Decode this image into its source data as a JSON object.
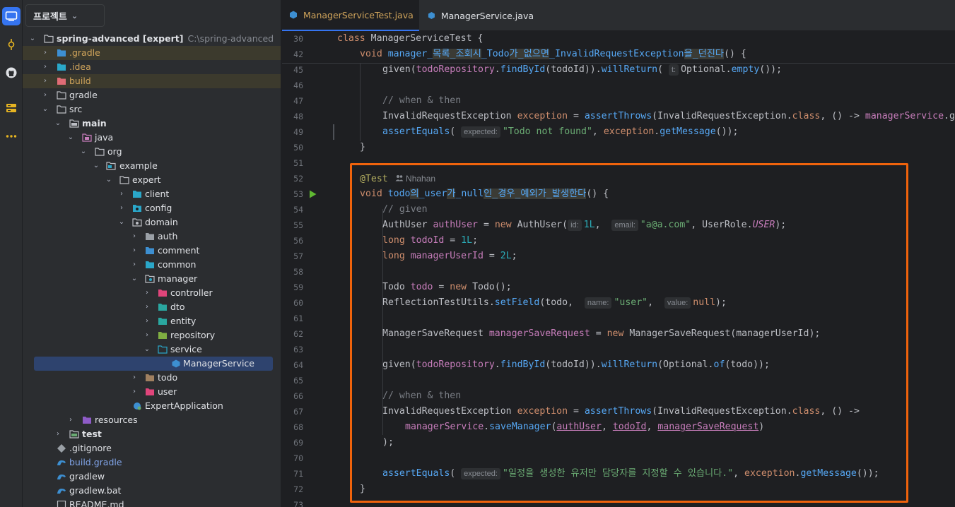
{
  "project": {
    "header": "프로젝트",
    "tree": [
      {
        "label": "spring-advanced [expert]",
        "sub": "C:\\spring-advanced",
        "icon": "module-folder-icon"
      },
      {
        "label": ".gradle",
        "icon": "folder-icon"
      },
      {
        "label": ".idea",
        "icon": "folder-icon"
      },
      {
        "label": "build",
        "icon": "folder-icon"
      },
      {
        "label": "gradle",
        "icon": "folder-icon"
      },
      {
        "label": "src",
        "icon": "folder-icon"
      },
      {
        "label": "main",
        "icon": "folder-icon"
      },
      {
        "label": "java",
        "icon": "source-folder-icon"
      },
      {
        "label": "org",
        "icon": "package-icon"
      },
      {
        "label": "example",
        "icon": "package-icon"
      },
      {
        "label": "expert",
        "icon": "package-icon"
      },
      {
        "label": "client",
        "icon": "package-icon"
      },
      {
        "label": "config",
        "icon": "package-icon"
      },
      {
        "label": "domain",
        "icon": "package-icon"
      },
      {
        "label": "auth",
        "icon": "package-icon"
      },
      {
        "label": "comment",
        "icon": "package-icon"
      },
      {
        "label": "common",
        "icon": "package-icon"
      },
      {
        "label": "manager",
        "icon": "package-icon"
      },
      {
        "label": "controller",
        "icon": "package-icon"
      },
      {
        "label": "dto",
        "icon": "package-icon"
      },
      {
        "label": "entity",
        "icon": "package-icon"
      },
      {
        "label": "repository",
        "icon": "package-icon"
      },
      {
        "label": "service",
        "icon": "package-icon"
      },
      {
        "label": "ManagerService",
        "icon": "interface-icon"
      },
      {
        "label": "todo",
        "icon": "package-icon"
      },
      {
        "label": "user",
        "icon": "package-icon"
      },
      {
        "label": "ExpertApplication",
        "icon": "spring-app-icon"
      },
      {
        "label": "resources",
        "icon": "resources-folder-icon"
      },
      {
        "label": "test",
        "icon": "test-folder-icon"
      },
      {
        "label": ".gitignore",
        "icon": "git-icon"
      },
      {
        "label": "build.gradle",
        "icon": "gradle-icon"
      },
      {
        "label": "gradlew",
        "icon": "gradle-icon"
      },
      {
        "label": "gradlew.bat",
        "icon": "gradle-icon"
      },
      {
        "label": "README.md",
        "icon": "markdown-icon"
      }
    ]
  },
  "tabs": [
    {
      "label": "ManagerServiceTest.java",
      "active": true
    },
    {
      "label": "ManagerService.java",
      "active": false
    }
  ],
  "line_numbers": [
    "30",
    "42",
    "45",
    "46",
    "47",
    "48",
    "49",
    "50",
    "51",
    "52",
    "53",
    "54",
    "55",
    "56",
    "57",
    "58",
    "59",
    "60",
    "61",
    "62",
    "63",
    "64",
    "65",
    "66",
    "67",
    "68",
    "69",
    "70",
    "71",
    "72",
    "73"
  ],
  "code": {
    "l30": {
      "kw": "class ",
      "name": "ManagerServiceTest {"
    },
    "l42": {
      "kw": "void ",
      "p1": "manager_",
      "h1": "목록_조회시",
      "p2": "_Todo",
      "h2": "가_없으면",
      "p3": "_InvalidRequestException",
      "h3": "을_던진다",
      "p4": "() {"
    },
    "l45": {
      "a": "given(",
      "b": "todoRepository",
      "c": ".",
      "d": "findById",
      "e": "(todoId)).",
      "f": "willReturn",
      "g": "( ",
      "hint": "t:",
      "h": "Optional.",
      "i": "empty",
      "j": "());"
    },
    "l47": "// when & then",
    "l48": {
      "a": "InvalidRequestException ",
      "b": "exception",
      "c": " = ",
      "d": "assertThrows",
      "e": "(InvalidRequestException.",
      "f": "class",
      "g": ", () -> ",
      "h": "managerService",
      "i": ".g"
    },
    "l49": {
      "a": "assertEquals",
      "b": "( ",
      "hint": "expected:",
      "c": "\"Todo not found\"",
      "d": ", ",
      "e": "exception",
      "f": ".",
      "g": "getMessage",
      "h": "());"
    },
    "l50": "}",
    "l52": {
      "an": "@Test",
      "author": "Nhahan"
    },
    "l53": {
      "kw": "void ",
      "p1": "todo",
      "h1": "의",
      "p2": "_user",
      "h2": "가",
      "p3": "_null",
      "h3": "인_경우_예외가_발생한다",
      "p4": "() {"
    },
    "l54": "// given",
    "l55": {
      "a": "AuthUser ",
      "b": "authUser",
      "c": " = ",
      "d": "new ",
      "e": "AuthUser(",
      "hint1": "id:",
      "f": "1L",
      "g": ",  ",
      "hint2": "email:",
      "h": "\"a@a.com\"",
      "i": ", UserRole.",
      "j": "USER",
      "k": ");"
    },
    "l56": {
      "kw": "long ",
      "v": "todoId",
      "eq": " = ",
      "n": "1L",
      "s": ";"
    },
    "l57": {
      "kw": "long ",
      "v": "managerUserId",
      "eq": " = ",
      "n": "2L",
      "s": ";"
    },
    "l59": {
      "a": "Todo ",
      "b": "todo",
      "c": " = ",
      "d": "new ",
      "e": "Todo();"
    },
    "l60": {
      "a": "ReflectionTestUtils.",
      "b": "setField",
      "c": "(todo,  ",
      "hint1": "name:",
      "d": "\"user\"",
      "e": ",  ",
      "hint2": "value:",
      "f": "null",
      "g": ");"
    },
    "l62": {
      "a": "ManagerSaveRequest ",
      "b": "managerSaveRequest",
      "c": " = ",
      "d": "new ",
      "e": "ManagerSaveRequest(managerUserId);"
    },
    "l64": {
      "a": "given(",
      "b": "todoRepository",
      "c": ".",
      "d": "findById",
      "e": "(todoId)).",
      "f": "willReturn",
      "g": "(Optional.",
      "h": "of",
      "i": "(todo));"
    },
    "l66": "// when & then",
    "l67": {
      "a": "InvalidRequestException ",
      "b": "exception",
      "c": " = ",
      "d": "assertThrows",
      "e": "(InvalidRequestException.",
      "f": "class",
      "g": ", () ->"
    },
    "l68": {
      "a": "managerService",
      "b": ".",
      "c": "saveManager",
      "d": "(",
      "e": "authUser",
      "f": ", ",
      "g": "todoId",
      "h": ", ",
      "i": "managerSaveRequest",
      "j": ")"
    },
    "l69": ");",
    "l71": {
      "a": "assertEquals",
      "b": "( ",
      "hint": "expected:",
      "c": "\"일정을 생성한 유저만 담당자를 지정할 수 있습니다.\"",
      "d": ", ",
      "e": "exception",
      "f": ".",
      "g": "getMessage",
      "h": "());"
    },
    "l72": "}"
  },
  "colors": {
    "accent": "#3574f0",
    "highlight_box": "#f0630c",
    "active_tab_label": "#d0a45b"
  }
}
